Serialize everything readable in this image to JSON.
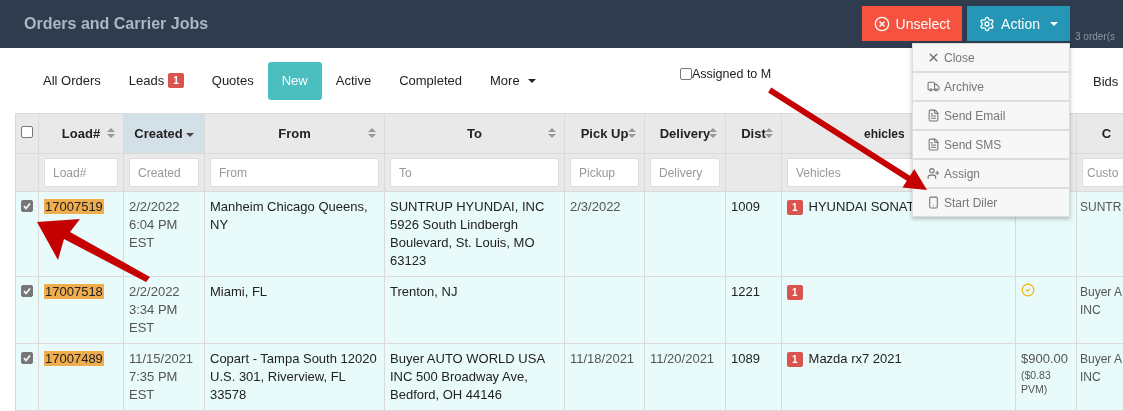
{
  "header": {
    "title": "Orders and Carrier Jobs",
    "buttons": [
      {
        "kind": "unselect",
        "label": "Unselect"
      },
      {
        "kind": "action",
        "label": "Action"
      }
    ],
    "count": "3 order(s"
  },
  "action_menu": [
    {
      "kind": "close",
      "label": "Close"
    },
    {
      "kind": "archive",
      "label": "Archive"
    },
    {
      "kind": "email",
      "label": "Send Email"
    },
    {
      "kind": "sms",
      "label": "Send SMS"
    },
    {
      "kind": "assign",
      "label": "Assign"
    },
    {
      "kind": "phone",
      "label": "Start Diler"
    }
  ],
  "tabs": [
    {
      "label": "All Orders",
      "selected": false
    },
    {
      "label": "Leads",
      "badge": "1",
      "selected": false
    },
    {
      "label": "Quotes",
      "selected": false
    },
    {
      "label": "New",
      "selected": true
    },
    {
      "label": "Active",
      "selected": false
    },
    {
      "label": "Completed",
      "selected": false
    },
    {
      "label": "More",
      "dropdown": true,
      "selected": false
    }
  ],
  "assigned_filter": {
    "label": "Assigned to M",
    "checked": false
  },
  "bids": {
    "label": "Bids"
  },
  "table": {
    "select_all": {
      "checked": false
    },
    "columns": [
      {
        "label": "Load#",
        "sortable": true,
        "placeholder": "Load#"
      },
      {
        "label": "Created",
        "sorted_desc": true,
        "placeholder": "Created",
        "active": true
      },
      {
        "label": "From",
        "sortable": true,
        "placeholder": "From"
      },
      {
        "label": "To",
        "sortable": true,
        "placeholder": "To"
      },
      {
        "label": "Pick Up",
        "sortable": true,
        "placeholder": "Pickup"
      },
      {
        "label": "Delivery",
        "sortable": true,
        "placeholder": "Delivery"
      },
      {
        "label": "Dist",
        "sortable": true
      },
      {
        "label": "ehicles",
        "placeholder": "Vehicles"
      },
      {},
      {
        "label": "C",
        "placeholder": "Custo"
      }
    ],
    "rows": [
      {
        "checked": true,
        "load": "17007519",
        "created": "2/2/2022 6:04 PM EST",
        "from": "Manheim Chicago Queens, NY",
        "to": "SUNTRUP HYUNDAI, INC 5926 South Lindbergh Boulevard, St. Louis, MO 63123",
        "pickup": "2/3/2022",
        "dist": "1009",
        "vehicle_count": "1",
        "vehicle": "HYUNDAI SONAT",
        "customer": "SUNTR"
      },
      {
        "checked": true,
        "load": "17007518",
        "created": "2/2/2022 3:34 PM EST",
        "from": "Miami, FL",
        "to": "Trenton, NJ",
        "dist": "1221",
        "vehicle_count": "1",
        "price": {
          "kind": "check"
        },
        "customer": "Buyer A INC"
      },
      {
        "checked": true,
        "load": "17007489",
        "created": "11/15/2021 7:35 PM EST",
        "from": "Copart - Tampa South 12020 U.S. 301, Riverview, FL 33578",
        "to": "Buyer AUTO WORLD USA INC 500 Broadway Ave, Bedford, OH 44146",
        "pickup": "11/18/2021",
        "delivery": "11/20/2021",
        "dist": "1089",
        "vehicle_count": "1",
        "vehicle": "Mazda rx7 2021",
        "price": {
          "kind": "text",
          "amount": "$900.00",
          "note": "($0.83 PVM)"
        },
        "customer": "Buyer A INC"
      }
    ]
  }
}
